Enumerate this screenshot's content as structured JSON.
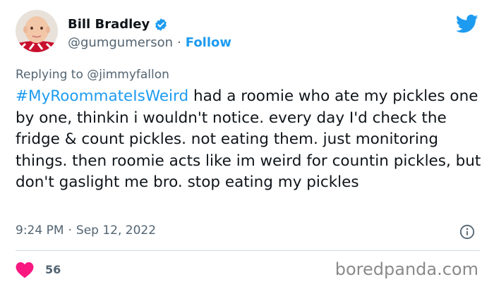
{
  "tweet": {
    "author_name": "Bill Bradley",
    "handle": "@gumgumerson",
    "separator": "·",
    "follow_label": "Follow",
    "replying_prefix": "Replying to",
    "replying_to": "@jimmyfallon",
    "hashtag": "#MyRoommateIsWeird",
    "body": " had a roomie who ate my pickles one by one, thinkin i wouldn't notice. every day I'd check the fridge & count pickles. not eating them. just monitoring things. then roomie acts like im weird for countin pickles, but don't gaslight me bro. stop eating my pickles",
    "time": "9:24 PM",
    "date": "Sep 12, 2022",
    "likes": "56"
  },
  "watermark": "boredpanda.com",
  "colors": {
    "link_blue": "#1d9bf0",
    "heart_red": "#f91880",
    "muted_text": "#536471",
    "text": "#0f1419"
  },
  "icons": {
    "verified": "verified-badge-icon",
    "brand": "twitter-bird-icon",
    "info": "info-icon",
    "like": "heart-icon"
  }
}
